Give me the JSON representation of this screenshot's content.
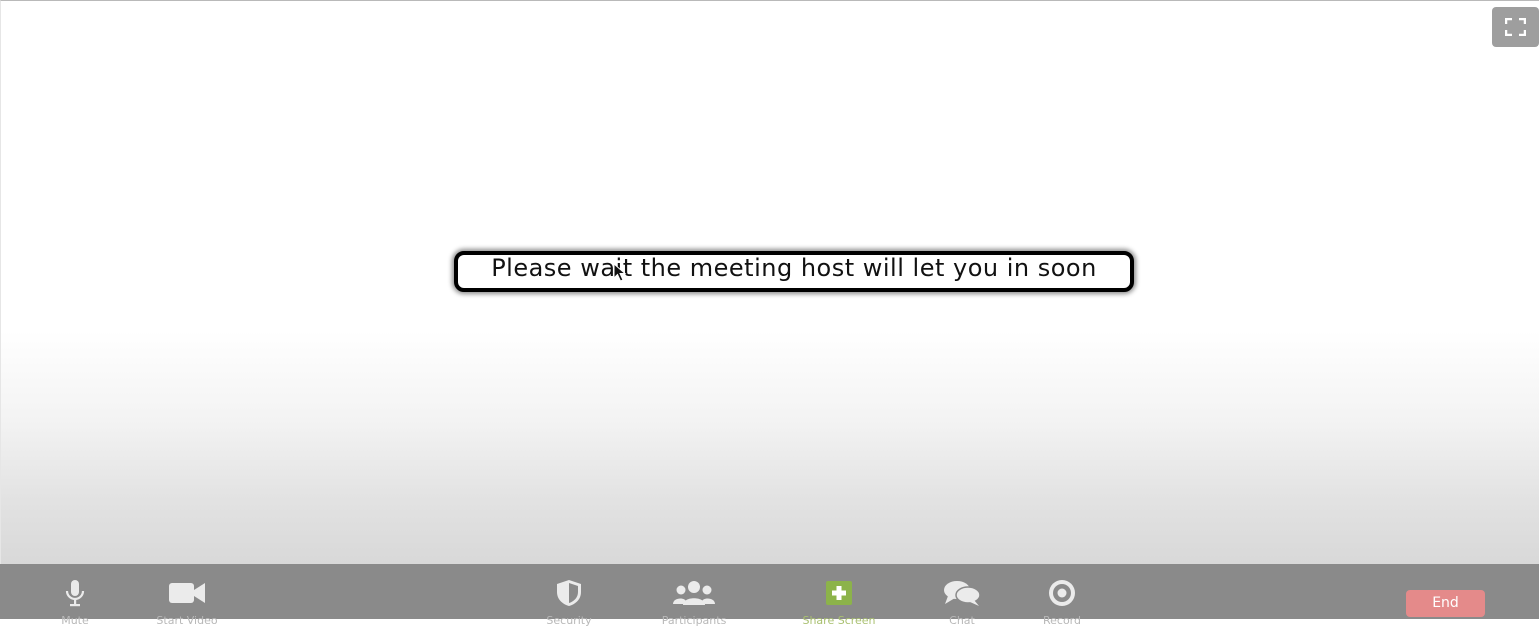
{
  "meeting": {
    "waiting_message": "Please wait the meeting host will let you in soon"
  },
  "toolbar": {
    "items": [
      {
        "label": "Mute",
        "icon": "microphone-icon"
      },
      {
        "label": "Start Video",
        "icon": "video-camera-icon"
      },
      {
        "label": "Security",
        "icon": "shield-icon"
      },
      {
        "label": "Participants",
        "icon": "participants-icon"
      },
      {
        "label": "Share Screen",
        "icon": "share-screen-icon"
      },
      {
        "label": "Chat",
        "icon": "chat-icon"
      },
      {
        "label": "Record",
        "icon": "record-icon"
      }
    ],
    "end_label": "End"
  },
  "colors": {
    "toolbar_bg": "#8a8a8a",
    "icon": "#ebebeb",
    "share_accent": "#8cb34a",
    "end_button": "#e48a8a"
  }
}
